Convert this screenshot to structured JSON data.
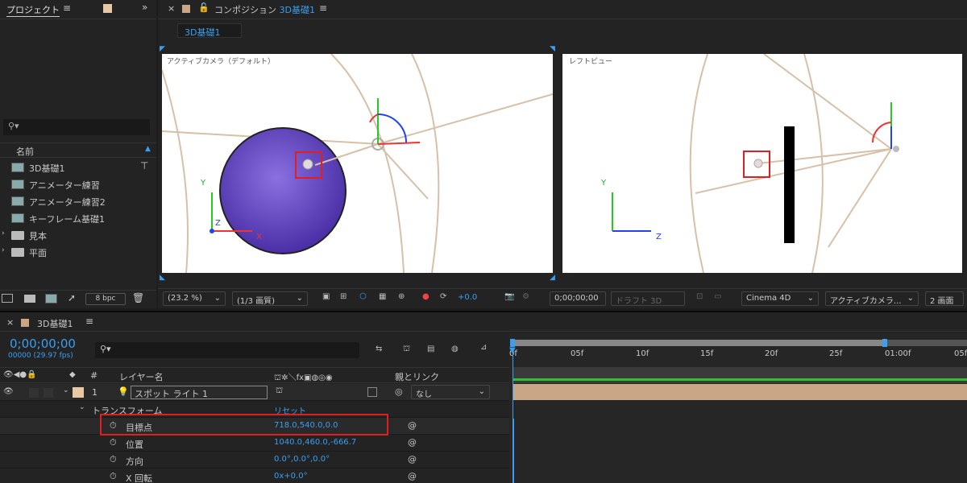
{
  "project": {
    "tab_label": "プロジェクト",
    "search_placeholder": "",
    "column_name": "名前",
    "items": [
      {
        "label": "3D基礎1",
        "type": "comp"
      },
      {
        "label": "アニメーター練習",
        "type": "comp"
      },
      {
        "label": "アニメーター練習2",
        "type": "comp"
      },
      {
        "label": "キーフレーム基礎1",
        "type": "comp"
      },
      {
        "label": "見本",
        "type": "folder"
      },
      {
        "label": "平面",
        "type": "folder"
      }
    ],
    "bpc": "8 bpc"
  },
  "composition": {
    "tab_prefix": "コンポジション",
    "tab_name": "3D基礎1",
    "sub_tab": "3D基礎1",
    "left_view_label": "アクティブカメラ（デフォルト）",
    "right_view_label": "レフトビュー",
    "axis_y": "Y",
    "axis_z": "Z",
    "axis_x": "X",
    "toolbar": {
      "zoom": "(23.2 %)",
      "resolution": "(1/3 画質)",
      "exposure": "+0.0",
      "timecode": "0;00;00;00",
      "draft3d": "ドラフト 3D",
      "renderer": "Cinema 4D",
      "camera": "アクティブカメラ...",
      "views": "2 画面"
    }
  },
  "timeline": {
    "tab_name": "3D基礎1",
    "timecode": "0;00;00;00",
    "frame_info": "00000 (29.97 fps)",
    "col_layer_name": "レイヤー名",
    "col_parent": "親とリンク",
    "layer": {
      "index": "1",
      "name": "スポット ライト 1",
      "parent": "なし"
    },
    "transform_label": "トランスフォーム",
    "reset_label": "リセット",
    "properties": [
      {
        "name": "目標点",
        "value": "718.0,540.0,0.0"
      },
      {
        "name": "位置",
        "value": "1040.0,460.0,-666.7"
      },
      {
        "name": "方向",
        "value": "0.0°,0.0°,0.0°"
      },
      {
        "name": "X 回転",
        "value": "0x+0.0°"
      }
    ],
    "ruler": [
      "0f",
      "05f",
      "10f",
      "15f",
      "20f",
      "25f",
      "01:00f",
      "05f"
    ]
  },
  "colors": {
    "accent": "#3a9ff0",
    "highlight": "#e02020",
    "layer_bar": "#c9a786",
    "sphere": "#6e52c8"
  }
}
